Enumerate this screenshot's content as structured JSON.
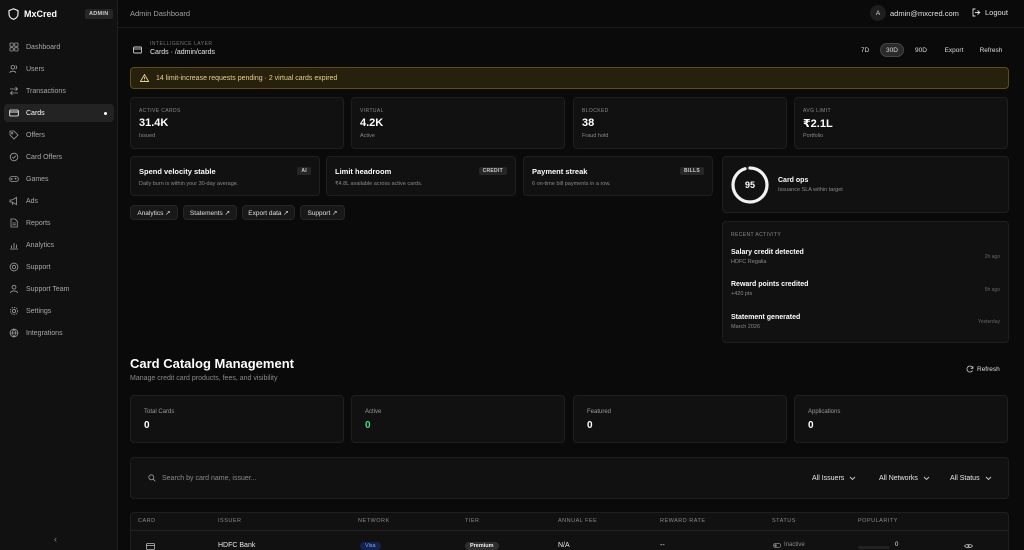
{
  "brand": {
    "name": "MxCred",
    "badge": "ADMIN"
  },
  "sidebar": {
    "items": [
      {
        "label": "Dashboard",
        "icon": "grid-icon"
      },
      {
        "label": "Users",
        "icon": "users-icon"
      },
      {
        "label": "Transactions",
        "icon": "arrows-icon"
      },
      {
        "label": "Cards",
        "icon": "card-icon",
        "active": true
      },
      {
        "label": "Offers",
        "icon": "tag-icon"
      },
      {
        "label": "Card Offers",
        "icon": "badge-icon"
      },
      {
        "label": "Games",
        "icon": "gamepad-icon"
      },
      {
        "label": "Ads",
        "icon": "megaphone-icon"
      },
      {
        "label": "Reports",
        "icon": "file-icon"
      },
      {
        "label": "Analytics",
        "icon": "chart-icon"
      },
      {
        "label": "Support",
        "icon": "lifebuoy-icon"
      },
      {
        "label": "Support Team",
        "icon": "team-icon"
      },
      {
        "label": "Settings",
        "icon": "gear-icon"
      },
      {
        "label": "Integrations",
        "icon": "globe-icon"
      }
    ],
    "collapse_glyph": "‹"
  },
  "topbar": {
    "title": "Admin Dashboard",
    "avatar_letter": "A",
    "email": "admin@mxcred.com",
    "logout": "Logout"
  },
  "header": {
    "layer_label": "INTELLIGENCE LAYER",
    "breadcrumb": "Cards · /admin/cards",
    "ranges": [
      "7D",
      "30D",
      "90D"
    ],
    "active_range": "30D",
    "export": "Export",
    "refresh": "Refresh"
  },
  "alert": {
    "text": "14 limit-increase requests pending · 2 virtual cards expired",
    "color": "#e8d28e"
  },
  "stats": [
    {
      "label": "ACTIVE CARDS",
      "value": "31.4K",
      "sub": "Issued"
    },
    {
      "label": "VIRTUAL",
      "value": "4.2K",
      "sub": "Active"
    },
    {
      "label": "BLOCKED",
      "value": "38",
      "sub": "Fraud hold"
    },
    {
      "label": "AVG LIMIT",
      "value": "₹2.1L",
      "sub": "Portfolio"
    }
  ],
  "insights": [
    {
      "title": "Spend velocity stable",
      "tag": "AI",
      "desc": "Daily burn is within your 30-day average."
    },
    {
      "title": "Limit headroom",
      "tag": "CREDIT",
      "desc": "₹4.8L available across active cards."
    },
    {
      "title": "Payment streak",
      "tag": "BILLS",
      "desc": "6 on-time bill payments in a row."
    }
  ],
  "quick_links": [
    "Analytics ↗",
    "Statements ↗",
    "Export data ↗",
    "Support ↗"
  ],
  "card_ops": {
    "score": "95",
    "score_fraction": 0.95,
    "title": "Card ops",
    "sub": "Issuance SLA within target"
  },
  "recent_activity": {
    "heading": "RECENT ACTIVITY",
    "items": [
      {
        "title": "Salary credit detected",
        "sub": "HDFC Regalia",
        "time": "2h ago"
      },
      {
        "title": "Reward points credited",
        "sub": "+420 pts",
        "time": "5h ago"
      },
      {
        "title": "Statement generated",
        "sub": "March 2026",
        "time": "Yesterday"
      }
    ]
  },
  "catalog": {
    "title": "Card Catalog Management",
    "subtitle": "Manage credit card products, fees, and visibility",
    "refresh": "Refresh",
    "summary": [
      {
        "label": "Total Cards",
        "value": "0"
      },
      {
        "label": "Active",
        "value": "0",
        "color": "#4ade80"
      },
      {
        "label": "Featured",
        "value": "0"
      },
      {
        "label": "Applications",
        "value": "0"
      }
    ],
    "search_placeholder": "Search by card name, issuer...",
    "filters": [
      "All Issuers",
      "All Networks",
      "All Status"
    ],
    "columns": [
      "CARD",
      "ISSUER",
      "NETWORK",
      "TIER",
      "ANNUAL FEE",
      "REWARD RATE",
      "STATUS",
      "POPULARITY"
    ],
    "rows": [
      {
        "issuer": "HDFC Bank",
        "network": "Visa",
        "tier": "Premium",
        "annual_fee": "N/A",
        "reward_rate": "--",
        "status": "Inactive",
        "popularity": "0"
      }
    ]
  }
}
